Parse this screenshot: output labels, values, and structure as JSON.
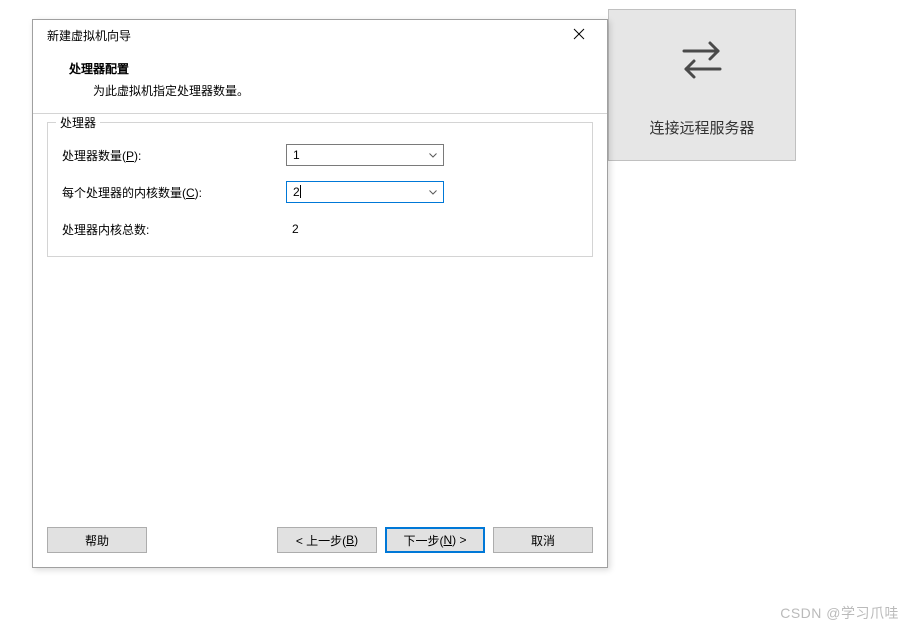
{
  "remote": {
    "label": "连接远程服务器"
  },
  "dialog": {
    "title": "新建虚拟机向导",
    "header": {
      "heading": "处理器配置",
      "sub": "为此虚拟机指定处理器数量。"
    },
    "group": {
      "legend": "处理器"
    },
    "rows": {
      "processors": {
        "label_pre": "处理器数量(",
        "label_key": "P",
        "label_post": "):",
        "value": "1"
      },
      "cores": {
        "label_pre": "每个处理器的内核数量(",
        "label_key": "C",
        "label_post": "):",
        "value": "2"
      },
      "total": {
        "label": "处理器内核总数:",
        "value": "2"
      }
    },
    "buttons": {
      "help": "帮助",
      "back_pre": "< 上一步(",
      "back_key": "B",
      "back_post": ")",
      "next_pre": "下一步(",
      "next_key": "N",
      "next_post": ") >",
      "cancel": "取消"
    }
  },
  "watermark": "CSDN @学习爪哇"
}
